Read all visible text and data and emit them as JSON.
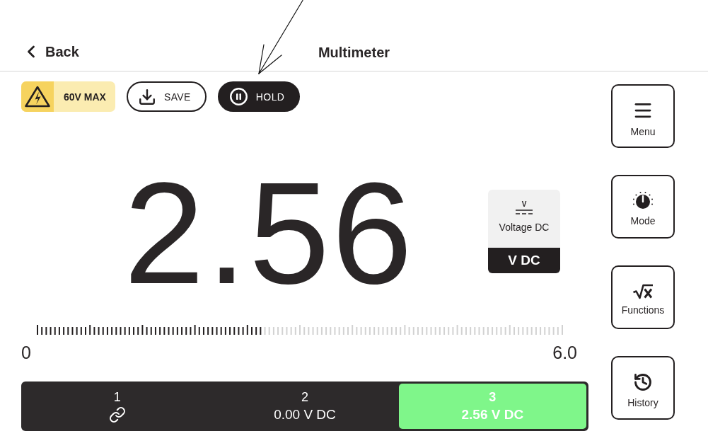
{
  "header": {
    "back": "Back",
    "title": "Multimeter"
  },
  "toolbar": {
    "warning": "60V MAX",
    "save": "SAVE",
    "hold": {
      "label": "HOLD",
      "on": true
    }
  },
  "reading": {
    "value": "2.56",
    "unit_card": {
      "symbol": "V",
      "mode": "Voltage DC",
      "unit": "V DC"
    }
  },
  "meter": {
    "level": 0.427,
    "min_label": "0",
    "max_label": "6.0"
  },
  "channels": [
    {
      "label": "1",
      "kind": "link",
      "selected": false
    },
    {
      "label": "2",
      "kind": "reading",
      "reading": "0.00 V DC",
      "selected": false
    },
    {
      "label": "3",
      "kind": "reading",
      "reading": "2.56 V DC",
      "selected": true
    }
  ],
  "side_buttons": [
    {
      "label": "Menu",
      "kind": "menu"
    },
    {
      "label": "Mode",
      "kind": "mode"
    },
    {
      "label": "Functions",
      "kind": "functions"
    },
    {
      "label": "History",
      "kind": "history"
    }
  ]
}
